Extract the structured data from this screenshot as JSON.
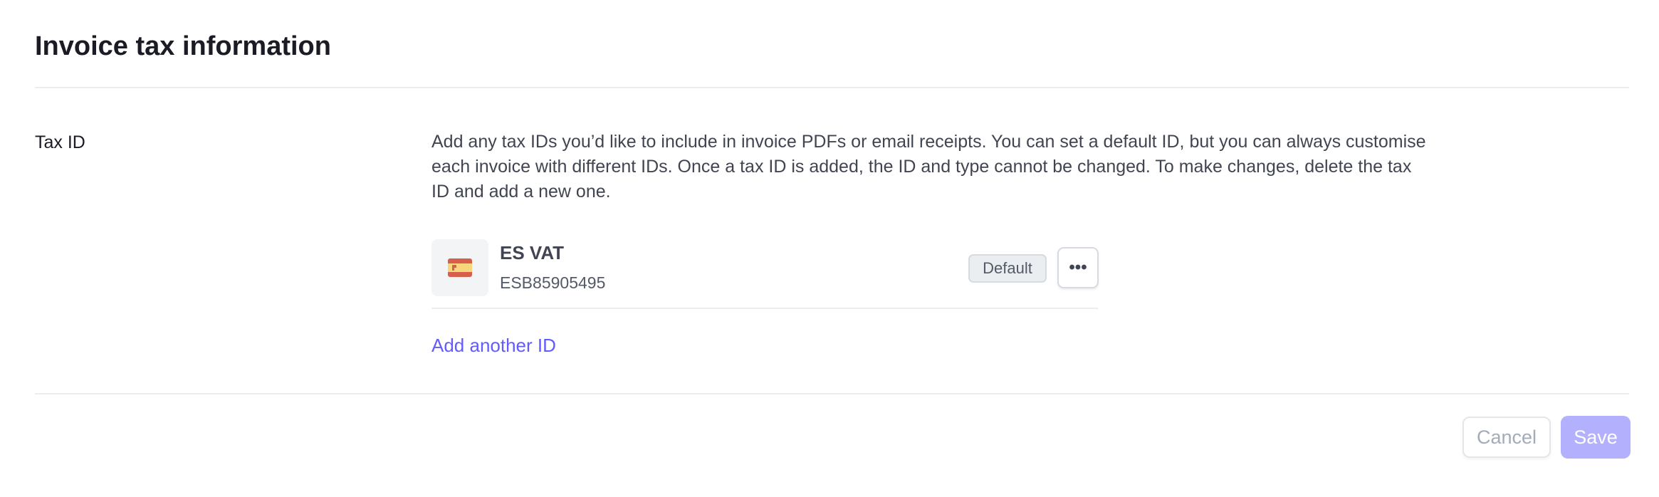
{
  "page": {
    "title": "Invoice tax information"
  },
  "tax_id": {
    "label": "Tax ID",
    "description": "Add any tax IDs you’d like to include in invoice PDFs or email receipts. You can set a default ID, but you can always customise each invoice with different IDs. Once a tax ID is added, the ID and type cannot be changed. To make changes, delete the tax ID and add a new one.",
    "items": [
      {
        "flag_icon": "spain-flag-icon",
        "type": "ES VAT",
        "value": "ESB85905495",
        "badge": "Default",
        "more_label": "•••"
      }
    ],
    "add_label": "Add another ID"
  },
  "footer": {
    "cancel_label": "Cancel",
    "save_label": "Save"
  },
  "colors": {
    "accent": "#635bff",
    "save_disabled": "#b3b0fd"
  }
}
